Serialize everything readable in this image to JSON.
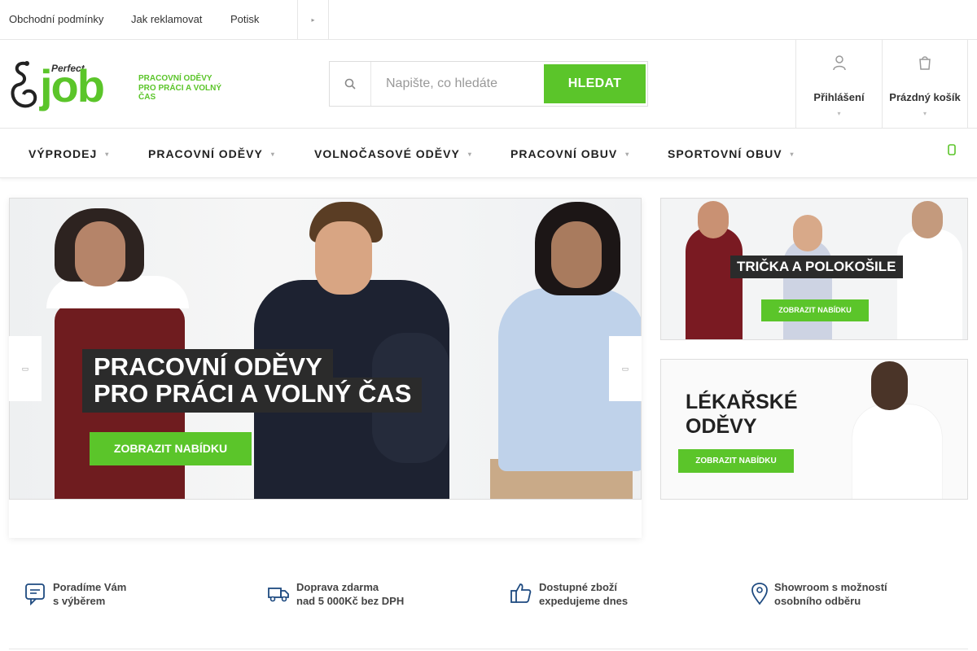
{
  "topbar": {
    "links": [
      "Obchodní podmínky",
      "Jak reklamovat",
      "Potisk"
    ],
    "more_icon": "chevron-right-icon"
  },
  "header": {
    "logo": {
      "perfect": "Perfect",
      "job": "job",
      "tagline_1": "PRACOVNÍ ODĚVY",
      "tagline_2": "PRO PRÁCI A VOLNÝ ČAS"
    },
    "search": {
      "placeholder": "Napište, co hledáte",
      "value": "",
      "button": "HLEDAT",
      "icon": "search-icon"
    },
    "login": {
      "label": "Přihlášení",
      "icon": "user-icon"
    },
    "cart": {
      "label": "Prázdný košík",
      "icon": "cart-icon"
    }
  },
  "nav": {
    "items": [
      "VÝPRODEJ",
      "PRACOVNÍ ODĚVY",
      "VOLNOČASOVÉ ODĚVY",
      "PRACOVNÍ OBUV",
      "SPORTOVNÍ OBUV"
    ],
    "extra_icon": "heart-icon"
  },
  "hero": {
    "title_1": "PRACOVNÍ ODĚVY",
    "title_2": "PRO PRÁCI A VOLNÝ ČAS",
    "cta": "ZOBRAZIT NABÍDKU"
  },
  "banners": [
    {
      "title": "TRIČKA A POLOKOŠILE",
      "cta": "ZOBRAZIT NABÍDKU"
    },
    {
      "title_1": "LÉKAŘSKÉ",
      "title_2": "ODĚVY",
      "cta": "ZOBRAZIT NABÍDKU"
    }
  ],
  "benefits": [
    {
      "icon": "chat-icon",
      "line_1": "Poradíme Vám",
      "line_2": "s výběrem"
    },
    {
      "icon": "truck-icon",
      "line_1": "Doprava zdarma",
      "line_2": "nad 5 000Kč bez DPH"
    },
    {
      "icon": "thumbs-up-icon",
      "line_1": "Dostupné zboží",
      "line_2": "expedujeme dnes"
    },
    {
      "icon": "location-pin-icon",
      "line_1": "Showroom s možností",
      "line_2": "osobního odběru"
    }
  ],
  "colors": {
    "accent": "#5bc52a",
    "dark_label": "#2b2b2b"
  }
}
